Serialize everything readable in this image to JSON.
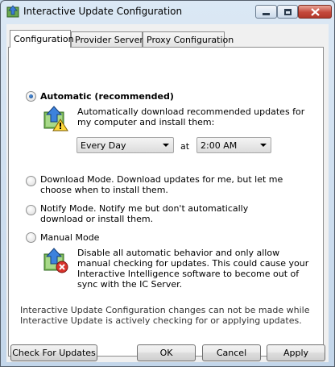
{
  "window": {
    "title": "Interactive Update Configuration",
    "close_color": "#c4483b"
  },
  "tabs": [
    {
      "label": "Configuration",
      "selected": true
    },
    {
      "label": "Provider Servers",
      "selected": false
    },
    {
      "label": "Proxy Configuration",
      "selected": false
    }
  ],
  "modes": {
    "automatic": {
      "label": "Automatic (recommended)",
      "selected": true,
      "description": "Automatically download recommended updates for my computer and install them:",
      "frequency": "Every Day",
      "at_label": "at",
      "time": "2:00 AM"
    },
    "download": {
      "label": "Download Mode.  Download updates for me, but let me choose when to install them.",
      "selected": false
    },
    "notify": {
      "label": "Notify Mode. Notify me but don't automatically download or install them.",
      "selected": false
    },
    "manual": {
      "label": "Manual Mode",
      "selected": false,
      "description": "Disable all automatic behavior and only allow manual checking for updates. This could cause your Interactive Intelligence software to become out of sync with the IC Server."
    }
  },
  "note": "Interactive Update Configuration changes can not be made while Interactive Update is actively checking for or applying updates.",
  "buttons": {
    "check": "Check For Updates",
    "ok": "OK",
    "cancel": "Cancel",
    "apply": "Apply"
  },
  "icons": {
    "app": "update-app-icon",
    "warning_shield": "update-warning-icon",
    "disabled_shield": "update-disabled-icon"
  }
}
